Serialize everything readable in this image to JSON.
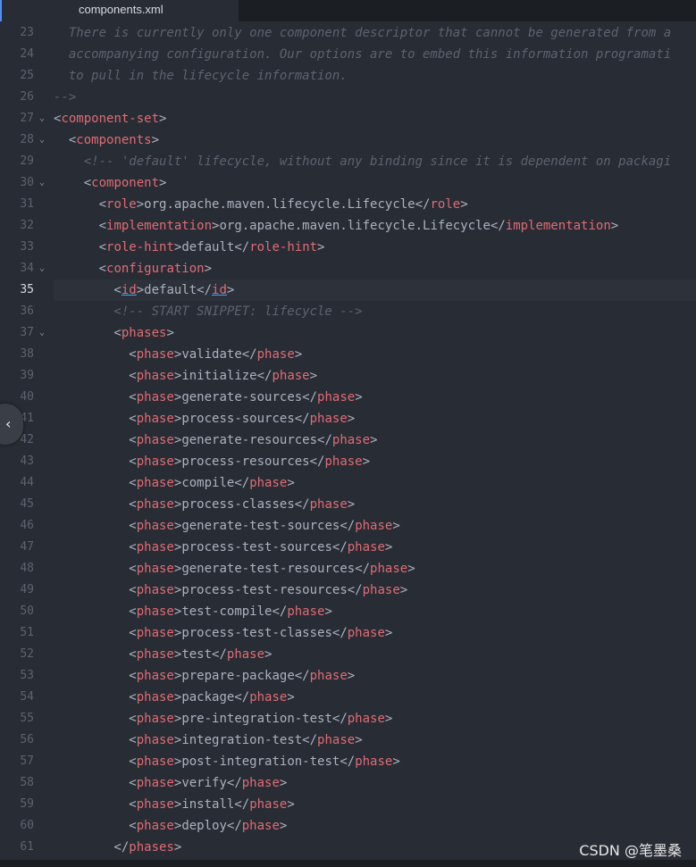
{
  "tab": {
    "label": "components.xml"
  },
  "watermark": "CSDN @笔墨桑",
  "collapse_icon": "chevron-left-icon",
  "current_line": 35,
  "lines": [
    {
      "n": "23",
      "fold": false,
      "segs": [
        {
          "c": "c",
          "t": "  There is currently only one component descriptor that cannot be generated from a"
        }
      ]
    },
    {
      "n": "24",
      "fold": false,
      "segs": [
        {
          "c": "c",
          "t": "  accompanying configuration. Our options are to embed this information programati"
        }
      ]
    },
    {
      "n": "25",
      "fold": false,
      "segs": [
        {
          "c": "c",
          "t": "  to pull in the lifecycle information."
        }
      ]
    },
    {
      "n": "26",
      "fold": false,
      "segs": [
        {
          "c": "c",
          "t": "-->"
        }
      ]
    },
    {
      "n": "27",
      "fold": true,
      "segs": [
        {
          "c": "p",
          "t": "<"
        },
        {
          "c": "t",
          "t": "component-set"
        },
        {
          "c": "p",
          "t": ">"
        }
      ]
    },
    {
      "n": "28",
      "fold": true,
      "segs": [
        {
          "c": "p",
          "t": "  <"
        },
        {
          "c": "t",
          "t": "components"
        },
        {
          "c": "p",
          "t": ">"
        }
      ]
    },
    {
      "n": "29",
      "fold": false,
      "segs": [
        {
          "c": "c",
          "t": "    <!-- 'default' lifecycle, without any binding since it is dependent on packagi"
        }
      ]
    },
    {
      "n": "30",
      "fold": true,
      "segs": [
        {
          "c": "p",
          "t": "    <"
        },
        {
          "c": "t",
          "t": "component"
        },
        {
          "c": "p",
          "t": ">"
        }
      ]
    },
    {
      "n": "31",
      "fold": false,
      "segs": [
        {
          "c": "p",
          "t": "      <"
        },
        {
          "c": "t",
          "t": "role"
        },
        {
          "c": "p",
          "t": ">"
        },
        {
          "c": "tx",
          "t": "org.apache.maven.lifecycle.Lifecycle"
        },
        {
          "c": "p",
          "t": "</"
        },
        {
          "c": "t",
          "t": "role"
        },
        {
          "c": "p",
          "t": ">"
        }
      ]
    },
    {
      "n": "32",
      "fold": false,
      "segs": [
        {
          "c": "p",
          "t": "      <"
        },
        {
          "c": "t",
          "t": "implementation"
        },
        {
          "c": "p",
          "t": ">"
        },
        {
          "c": "tx",
          "t": "org.apache.maven.lifecycle.Lifecycle"
        },
        {
          "c": "p",
          "t": "</"
        },
        {
          "c": "t",
          "t": "implementation"
        },
        {
          "c": "p",
          "t": ">"
        }
      ]
    },
    {
      "n": "33",
      "fold": false,
      "segs": [
        {
          "c": "p",
          "t": "      <"
        },
        {
          "c": "t",
          "t": "role-hint"
        },
        {
          "c": "p",
          "t": ">"
        },
        {
          "c": "tx",
          "t": "default"
        },
        {
          "c": "p",
          "t": "</"
        },
        {
          "c": "t",
          "t": "role-hint"
        },
        {
          "c": "p",
          "t": ">"
        }
      ]
    },
    {
      "n": "34",
      "fold": true,
      "segs": [
        {
          "c": "p",
          "t": "      <"
        },
        {
          "c": "t",
          "t": "configuration"
        },
        {
          "c": "p",
          "t": ">"
        }
      ]
    },
    {
      "n": "35",
      "fold": false,
      "segs": [
        {
          "c": "p",
          "t": "        <"
        },
        {
          "c": "t u",
          "t": "id"
        },
        {
          "c": "p",
          "t": ">"
        },
        {
          "c": "tx",
          "t": "default"
        },
        {
          "c": "p",
          "t": "</"
        },
        {
          "c": "t u",
          "t": "id"
        },
        {
          "c": "p",
          "t": ">"
        }
      ]
    },
    {
      "n": "36",
      "fold": false,
      "segs": [
        {
          "c": "c",
          "t": "        <!-- START SNIPPET: lifecycle -->"
        }
      ]
    },
    {
      "n": "37",
      "fold": true,
      "segs": [
        {
          "c": "p",
          "t": "        <"
        },
        {
          "c": "t",
          "t": "phases"
        },
        {
          "c": "p",
          "t": ">"
        }
      ]
    },
    {
      "n": "38",
      "fold": false,
      "segs": [
        {
          "c": "p",
          "t": "          <"
        },
        {
          "c": "t",
          "t": "phase"
        },
        {
          "c": "p",
          "t": ">"
        },
        {
          "c": "tx",
          "t": "validate"
        },
        {
          "c": "p",
          "t": "</"
        },
        {
          "c": "t",
          "t": "phase"
        },
        {
          "c": "p",
          "t": ">"
        }
      ]
    },
    {
      "n": "39",
      "fold": false,
      "segs": [
        {
          "c": "p",
          "t": "          <"
        },
        {
          "c": "t",
          "t": "phase"
        },
        {
          "c": "p",
          "t": ">"
        },
        {
          "c": "tx",
          "t": "initialize"
        },
        {
          "c": "p",
          "t": "</"
        },
        {
          "c": "t",
          "t": "phase"
        },
        {
          "c": "p",
          "t": ">"
        }
      ]
    },
    {
      "n": "40",
      "fold": false,
      "segs": [
        {
          "c": "p",
          "t": "          <"
        },
        {
          "c": "t",
          "t": "phase"
        },
        {
          "c": "p",
          "t": ">"
        },
        {
          "c": "tx",
          "t": "generate-sources"
        },
        {
          "c": "p",
          "t": "</"
        },
        {
          "c": "t",
          "t": "phase"
        },
        {
          "c": "p",
          "t": ">"
        }
      ]
    },
    {
      "n": "41",
      "fold": false,
      "segs": [
        {
          "c": "p",
          "t": "          <"
        },
        {
          "c": "t",
          "t": "phase"
        },
        {
          "c": "p",
          "t": ">"
        },
        {
          "c": "tx",
          "t": "process-sources"
        },
        {
          "c": "p",
          "t": "</"
        },
        {
          "c": "t",
          "t": "phase"
        },
        {
          "c": "p",
          "t": ">"
        }
      ]
    },
    {
      "n": "42",
      "fold": false,
      "segs": [
        {
          "c": "p",
          "t": "          <"
        },
        {
          "c": "t",
          "t": "phase"
        },
        {
          "c": "p",
          "t": ">"
        },
        {
          "c": "tx",
          "t": "generate-resources"
        },
        {
          "c": "p",
          "t": "</"
        },
        {
          "c": "t",
          "t": "phase"
        },
        {
          "c": "p",
          "t": ">"
        }
      ]
    },
    {
      "n": "43",
      "fold": false,
      "segs": [
        {
          "c": "p",
          "t": "          <"
        },
        {
          "c": "t",
          "t": "phase"
        },
        {
          "c": "p",
          "t": ">"
        },
        {
          "c": "tx",
          "t": "process-resources"
        },
        {
          "c": "p",
          "t": "</"
        },
        {
          "c": "t",
          "t": "phase"
        },
        {
          "c": "p",
          "t": ">"
        }
      ]
    },
    {
      "n": "44",
      "fold": false,
      "segs": [
        {
          "c": "p",
          "t": "          <"
        },
        {
          "c": "t",
          "t": "phase"
        },
        {
          "c": "p",
          "t": ">"
        },
        {
          "c": "tx",
          "t": "compile"
        },
        {
          "c": "p",
          "t": "</"
        },
        {
          "c": "t",
          "t": "phase"
        },
        {
          "c": "p",
          "t": ">"
        }
      ]
    },
    {
      "n": "45",
      "fold": false,
      "segs": [
        {
          "c": "p",
          "t": "          <"
        },
        {
          "c": "t",
          "t": "phase"
        },
        {
          "c": "p",
          "t": ">"
        },
        {
          "c": "tx",
          "t": "process-classes"
        },
        {
          "c": "p",
          "t": "</"
        },
        {
          "c": "t",
          "t": "phase"
        },
        {
          "c": "p",
          "t": ">"
        }
      ]
    },
    {
      "n": "46",
      "fold": false,
      "segs": [
        {
          "c": "p",
          "t": "          <"
        },
        {
          "c": "t",
          "t": "phase"
        },
        {
          "c": "p",
          "t": ">"
        },
        {
          "c": "tx",
          "t": "generate-test-sources"
        },
        {
          "c": "p",
          "t": "</"
        },
        {
          "c": "t",
          "t": "phase"
        },
        {
          "c": "p",
          "t": ">"
        }
      ]
    },
    {
      "n": "47",
      "fold": false,
      "segs": [
        {
          "c": "p",
          "t": "          <"
        },
        {
          "c": "t",
          "t": "phase"
        },
        {
          "c": "p",
          "t": ">"
        },
        {
          "c": "tx",
          "t": "process-test-sources"
        },
        {
          "c": "p",
          "t": "</"
        },
        {
          "c": "t",
          "t": "phase"
        },
        {
          "c": "p",
          "t": ">"
        }
      ]
    },
    {
      "n": "48",
      "fold": false,
      "segs": [
        {
          "c": "p",
          "t": "          <"
        },
        {
          "c": "t",
          "t": "phase"
        },
        {
          "c": "p",
          "t": ">"
        },
        {
          "c": "tx",
          "t": "generate-test-resources"
        },
        {
          "c": "p",
          "t": "</"
        },
        {
          "c": "t",
          "t": "phase"
        },
        {
          "c": "p",
          "t": ">"
        }
      ]
    },
    {
      "n": "49",
      "fold": false,
      "segs": [
        {
          "c": "p",
          "t": "          <"
        },
        {
          "c": "t",
          "t": "phase"
        },
        {
          "c": "p",
          "t": ">"
        },
        {
          "c": "tx",
          "t": "process-test-resources"
        },
        {
          "c": "p",
          "t": "</"
        },
        {
          "c": "t",
          "t": "phase"
        },
        {
          "c": "p",
          "t": ">"
        }
      ]
    },
    {
      "n": "50",
      "fold": false,
      "segs": [
        {
          "c": "p",
          "t": "          <"
        },
        {
          "c": "t",
          "t": "phase"
        },
        {
          "c": "p",
          "t": ">"
        },
        {
          "c": "tx",
          "t": "test-compile"
        },
        {
          "c": "p",
          "t": "</"
        },
        {
          "c": "t",
          "t": "phase"
        },
        {
          "c": "p",
          "t": ">"
        }
      ]
    },
    {
      "n": "51",
      "fold": false,
      "segs": [
        {
          "c": "p",
          "t": "          <"
        },
        {
          "c": "t",
          "t": "phase"
        },
        {
          "c": "p",
          "t": ">"
        },
        {
          "c": "tx",
          "t": "process-test-classes"
        },
        {
          "c": "p",
          "t": "</"
        },
        {
          "c": "t",
          "t": "phase"
        },
        {
          "c": "p",
          "t": ">"
        }
      ]
    },
    {
      "n": "52",
      "fold": false,
      "segs": [
        {
          "c": "p",
          "t": "          <"
        },
        {
          "c": "t",
          "t": "phase"
        },
        {
          "c": "p",
          "t": ">"
        },
        {
          "c": "tx",
          "t": "test"
        },
        {
          "c": "p",
          "t": "</"
        },
        {
          "c": "t",
          "t": "phase"
        },
        {
          "c": "p",
          "t": ">"
        }
      ]
    },
    {
      "n": "53",
      "fold": false,
      "segs": [
        {
          "c": "p",
          "t": "          <"
        },
        {
          "c": "t",
          "t": "phase"
        },
        {
          "c": "p",
          "t": ">"
        },
        {
          "c": "tx",
          "t": "prepare-package"
        },
        {
          "c": "p",
          "t": "</"
        },
        {
          "c": "t",
          "t": "phase"
        },
        {
          "c": "p",
          "t": ">"
        }
      ]
    },
    {
      "n": "54",
      "fold": false,
      "segs": [
        {
          "c": "p",
          "t": "          <"
        },
        {
          "c": "t",
          "t": "phase"
        },
        {
          "c": "p",
          "t": ">"
        },
        {
          "c": "tx",
          "t": "package"
        },
        {
          "c": "p",
          "t": "</"
        },
        {
          "c": "t",
          "t": "phase"
        },
        {
          "c": "p",
          "t": ">"
        }
      ]
    },
    {
      "n": "55",
      "fold": false,
      "segs": [
        {
          "c": "p",
          "t": "          <"
        },
        {
          "c": "t",
          "t": "phase"
        },
        {
          "c": "p",
          "t": ">"
        },
        {
          "c": "tx",
          "t": "pre-integration-test"
        },
        {
          "c": "p",
          "t": "</"
        },
        {
          "c": "t",
          "t": "phase"
        },
        {
          "c": "p",
          "t": ">"
        }
      ]
    },
    {
      "n": "56",
      "fold": false,
      "segs": [
        {
          "c": "p",
          "t": "          <"
        },
        {
          "c": "t",
          "t": "phase"
        },
        {
          "c": "p",
          "t": ">"
        },
        {
          "c": "tx",
          "t": "integration-test"
        },
        {
          "c": "p",
          "t": "</"
        },
        {
          "c": "t",
          "t": "phase"
        },
        {
          "c": "p",
          "t": ">"
        }
      ]
    },
    {
      "n": "57",
      "fold": false,
      "segs": [
        {
          "c": "p",
          "t": "          <"
        },
        {
          "c": "t",
          "t": "phase"
        },
        {
          "c": "p",
          "t": ">"
        },
        {
          "c": "tx",
          "t": "post-integration-test"
        },
        {
          "c": "p",
          "t": "</"
        },
        {
          "c": "t",
          "t": "phase"
        },
        {
          "c": "p",
          "t": ">"
        }
      ]
    },
    {
      "n": "58",
      "fold": false,
      "segs": [
        {
          "c": "p",
          "t": "          <"
        },
        {
          "c": "t",
          "t": "phase"
        },
        {
          "c": "p",
          "t": ">"
        },
        {
          "c": "tx",
          "t": "verify"
        },
        {
          "c": "p",
          "t": "</"
        },
        {
          "c": "t",
          "t": "phase"
        },
        {
          "c": "p",
          "t": ">"
        }
      ]
    },
    {
      "n": "59",
      "fold": false,
      "segs": [
        {
          "c": "p",
          "t": "          <"
        },
        {
          "c": "t",
          "t": "phase"
        },
        {
          "c": "p",
          "t": ">"
        },
        {
          "c": "tx",
          "t": "install"
        },
        {
          "c": "p",
          "t": "</"
        },
        {
          "c": "t",
          "t": "phase"
        },
        {
          "c": "p",
          "t": ">"
        }
      ]
    },
    {
      "n": "60",
      "fold": false,
      "segs": [
        {
          "c": "p",
          "t": "          <"
        },
        {
          "c": "t",
          "t": "phase"
        },
        {
          "c": "p",
          "t": ">"
        },
        {
          "c": "tx",
          "t": "deploy"
        },
        {
          "c": "p",
          "t": "</"
        },
        {
          "c": "t",
          "t": "phase"
        },
        {
          "c": "p",
          "t": ">"
        }
      ]
    },
    {
      "n": "61",
      "fold": false,
      "segs": [
        {
          "c": "p",
          "t": "        </"
        },
        {
          "c": "t",
          "t": "phases"
        },
        {
          "c": "p",
          "t": ">"
        }
      ]
    }
  ]
}
